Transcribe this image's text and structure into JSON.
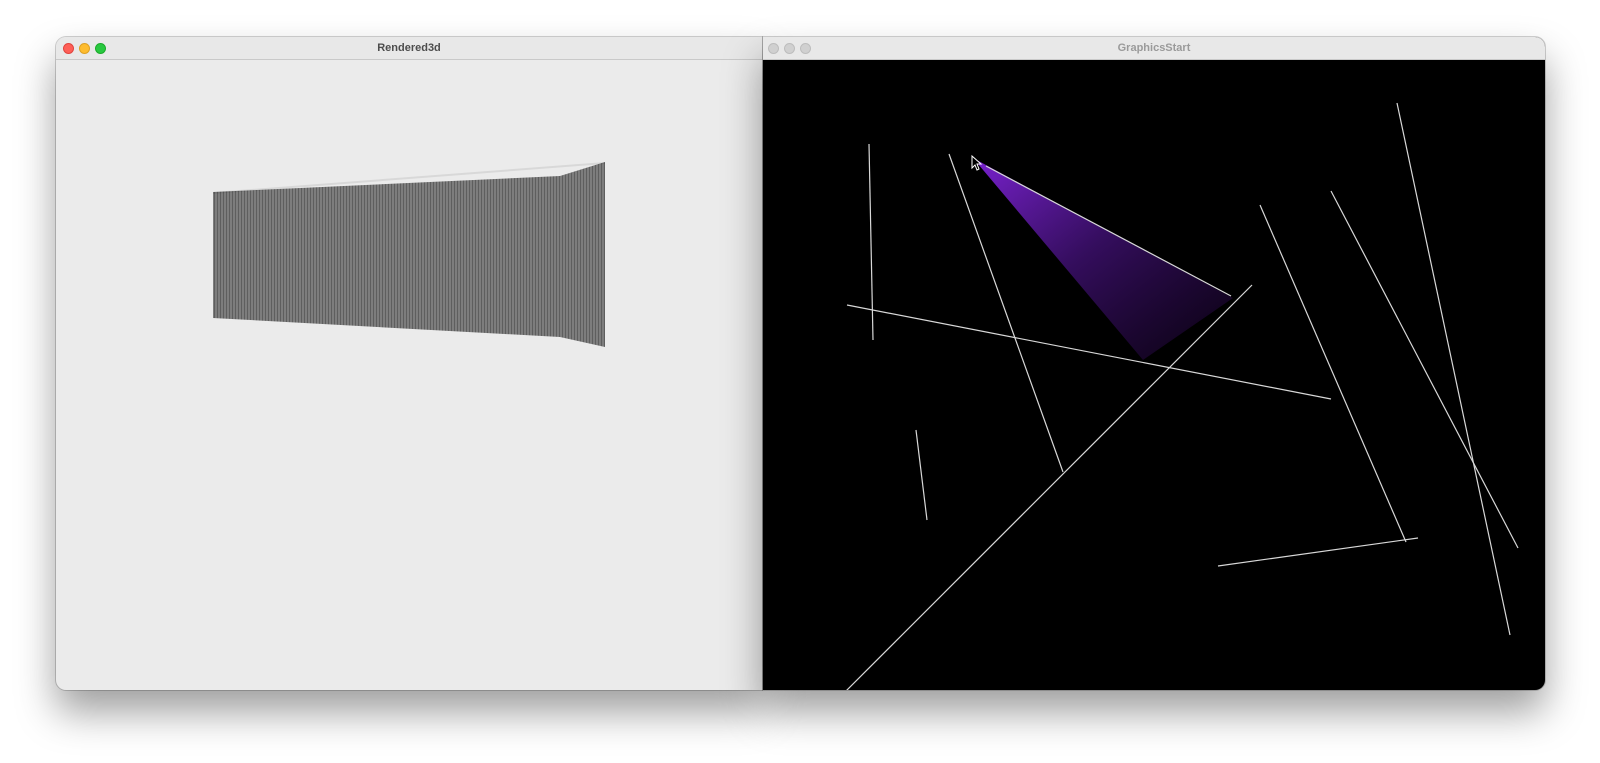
{
  "windows": {
    "left": {
      "title": "Rendered3d",
      "active": true,
      "background": "#ebebeb",
      "wall_color": "#7a7a7a"
    },
    "right": {
      "title": "GraphicsStart",
      "active": false,
      "background": "#000000",
      "line_color": "#d8d8d8",
      "view_cone_color": "#6a1fb5"
    }
  },
  "icons": {
    "close": "close-icon",
    "minimize": "minimize-icon",
    "maximize": "maximize-icon",
    "cursor": "arrow-cursor-icon"
  }
}
